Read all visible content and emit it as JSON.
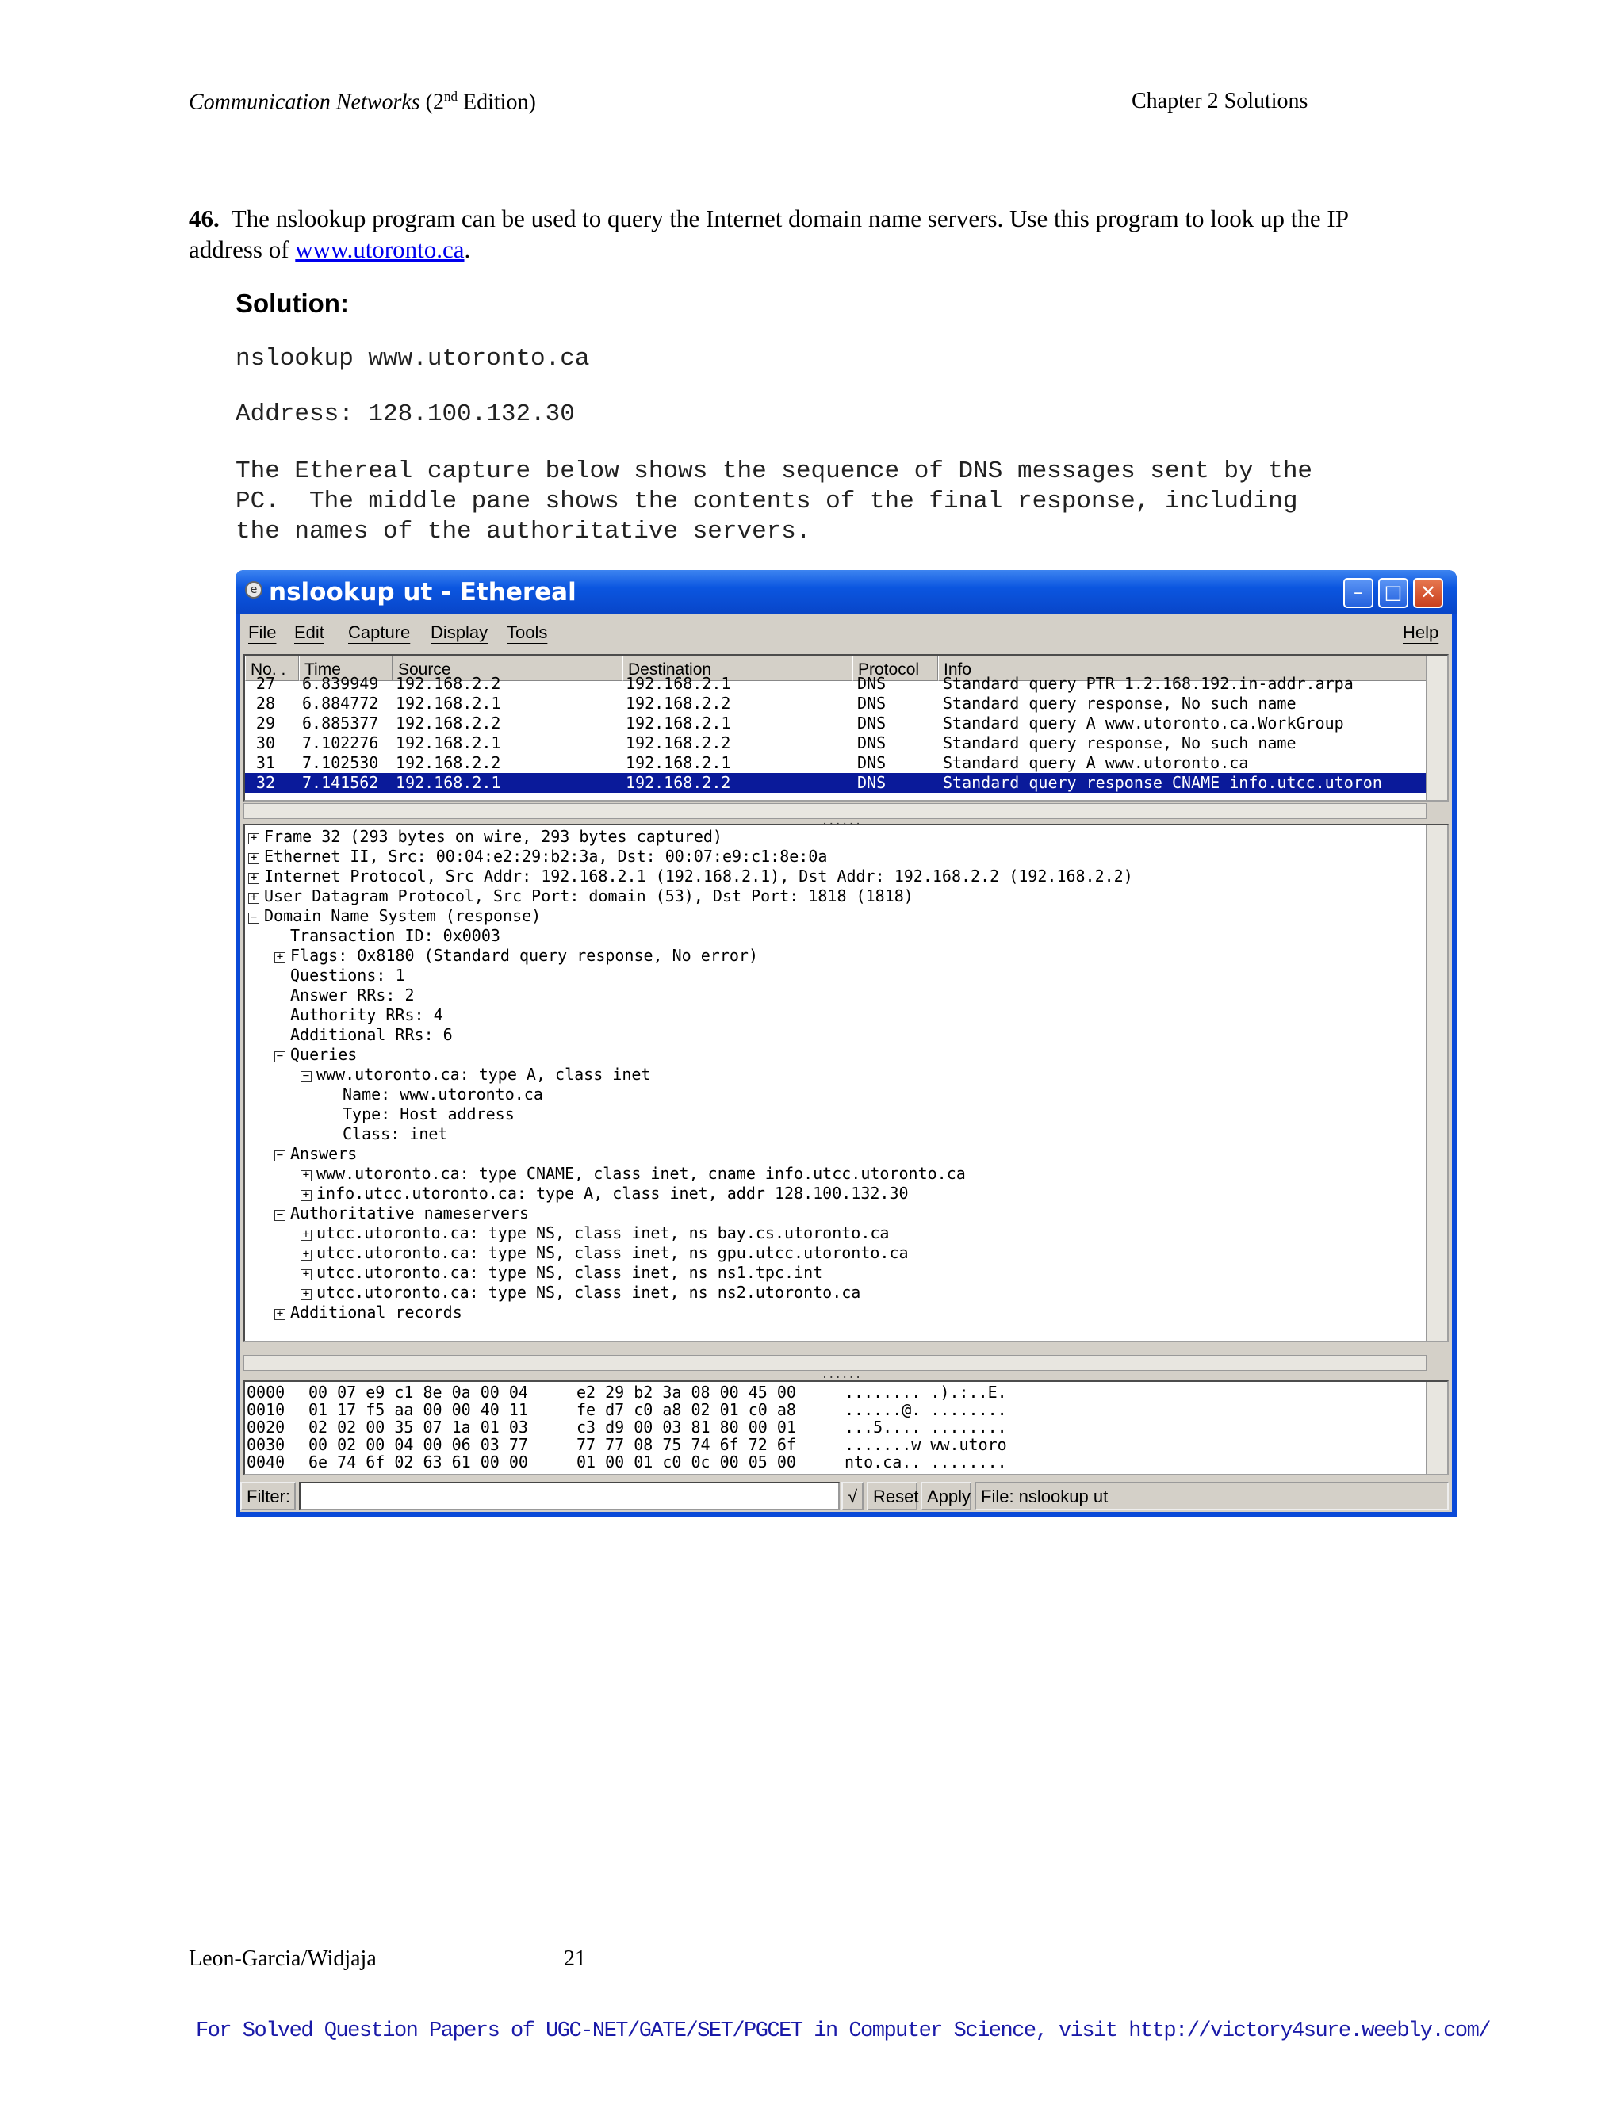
{
  "header": {
    "book_title": "Communication Networks",
    "edition_pre": "(2",
    "edition_sup": "nd",
    "edition_post": " Edition)",
    "chapter": "Chapter 2 Solutions"
  },
  "question": {
    "number": "46.",
    "text_before": "The nslookup  program can be used to query the Internet domain name servers. Use this program to look up the IP address of ",
    "link": "www.utoronto.ca",
    "text_after": "."
  },
  "solution": {
    "heading": "Solution:",
    "command": "nslookup www.utoronto.ca",
    "address": "Address: 128.100.132.30",
    "description": "The Ethereal capture below shows the sequence of DNS messages sent by the\nPC.  The middle pane shows the contents of the final response, including\nthe names of the authoritative servers."
  },
  "window": {
    "title": "nslookup ut - Ethereal",
    "icon": "ethereal-icon",
    "menus": [
      "File",
      "Edit",
      "Capture",
      "Display",
      "Tools"
    ],
    "help_menu": "Help",
    "columns": [
      "No. .",
      "Time",
      "Source",
      "Destination",
      "Protocol",
      "Info"
    ],
    "packets": [
      {
        "no": "27",
        "time": "6.839949",
        "src": "192.168.2.2",
        "dst": "192.168.2.1",
        "proto": "DNS",
        "info": "Standard query PTR 1.2.168.192.in-addr.arpa"
      },
      {
        "no": "28",
        "time": "6.884772",
        "src": "192.168.2.1",
        "dst": "192.168.2.2",
        "proto": "DNS",
        "info": "Standard query response, No such name"
      },
      {
        "no": "29",
        "time": "6.885377",
        "src": "192.168.2.2",
        "dst": "192.168.2.1",
        "proto": "DNS",
        "info": "Standard query A www.utoronto.ca.WorkGroup"
      },
      {
        "no": "30",
        "time": "7.102276",
        "src": "192.168.2.1",
        "dst": "192.168.2.2",
        "proto": "DNS",
        "info": "Standard query response, No such name"
      },
      {
        "no": "31",
        "time": "7.102530",
        "src": "192.168.2.2",
        "dst": "192.168.2.1",
        "proto": "DNS",
        "info": "Standard query A www.utoronto.ca"
      },
      {
        "no": "32",
        "time": "7.141562",
        "src": "192.168.2.1",
        "dst": "192.168.2.2",
        "proto": "DNS",
        "info": "Standard query response CNAME info.utcc.utoron"
      }
    ],
    "selected_packet": "32",
    "tree": [
      {
        "indent": 0,
        "exp": "+",
        "text": "Frame 32 (293 bytes on wire, 293 bytes captured)"
      },
      {
        "indent": 0,
        "exp": "+",
        "text": "Ethernet II, Src: 00:04:e2:29:b2:3a, Dst: 00:07:e9:c1:8e:0a"
      },
      {
        "indent": 0,
        "exp": "+",
        "text": "Internet Protocol, Src Addr: 192.168.2.1 (192.168.2.1), Dst Addr: 192.168.2.2 (192.168.2.2)"
      },
      {
        "indent": 0,
        "exp": "+",
        "text": "User Datagram Protocol, Src Port: domain (53), Dst Port: 1818 (1818)"
      },
      {
        "indent": 0,
        "exp": "-",
        "text": "Domain Name System (response)"
      },
      {
        "indent": 1,
        "exp": "",
        "text": "Transaction ID: 0x0003"
      },
      {
        "indent": 1,
        "exp": "+",
        "text": "Flags: 0x8180 (Standard query response, No error)"
      },
      {
        "indent": 1,
        "exp": "",
        "text": "Questions: 1"
      },
      {
        "indent": 1,
        "exp": "",
        "text": "Answer RRs: 2"
      },
      {
        "indent": 1,
        "exp": "",
        "text": "Authority RRs: 4"
      },
      {
        "indent": 1,
        "exp": "",
        "text": "Additional RRs: 6"
      },
      {
        "indent": 1,
        "exp": "-",
        "text": "Queries"
      },
      {
        "indent": 2,
        "exp": "-",
        "text": "www.utoronto.ca: type A, class inet"
      },
      {
        "indent": 3,
        "exp": "",
        "text": "Name: www.utoronto.ca"
      },
      {
        "indent": 3,
        "exp": "",
        "text": "Type: Host address"
      },
      {
        "indent": 3,
        "exp": "",
        "text": "Class: inet"
      },
      {
        "indent": 1,
        "exp": "-",
        "text": "Answers"
      },
      {
        "indent": 2,
        "exp": "+",
        "text": "www.utoronto.ca: type CNAME, class inet, cname info.utcc.utoronto.ca"
      },
      {
        "indent": 2,
        "exp": "+",
        "text": "info.utcc.utoronto.ca: type A, class inet, addr 128.100.132.30"
      },
      {
        "indent": 1,
        "exp": "-",
        "text": "Authoritative nameservers"
      },
      {
        "indent": 2,
        "exp": "+",
        "text": "utcc.utoronto.ca: type NS, class inet, ns bay.cs.utoronto.ca"
      },
      {
        "indent": 2,
        "exp": "+",
        "text": "utcc.utoronto.ca: type NS, class inet, ns gpu.utcc.utoronto.ca"
      },
      {
        "indent": 2,
        "exp": "+",
        "text": "utcc.utoronto.ca: type NS, class inet, ns ns1.tpc.int"
      },
      {
        "indent": 2,
        "exp": "+",
        "text": "utcc.utoronto.ca: type NS, class inet, ns ns2.utoronto.ca"
      },
      {
        "indent": 1,
        "exp": "+",
        "text": "Additional records"
      }
    ],
    "hex": [
      {
        "off": "0000",
        "bytes1": "00 07 e9 c1 8e 0a 00 04",
        "bytes2": "e2 29 b2 3a 08 00 45 00",
        "ascii": "........ .).:..E."
      },
      {
        "off": "0010",
        "bytes1": "01 17 f5 aa 00 00 40 11",
        "bytes2": "fe d7 c0 a8 02 01 c0 a8",
        "ascii": "......@. ........"
      },
      {
        "off": "0020",
        "bytes1": "02 02 00 35 07 1a 01 03",
        "bytes2": "c3 d9 00 03 81 80 00 01",
        "ascii": "...5.... ........"
      },
      {
        "off": "0030",
        "bytes1": "00 02 00 04 00 06 03 77",
        "bytes2": "77 77 08 75 74 6f 72 6f",
        "ascii": ".......w ww.utoro"
      },
      {
        "off": "0040",
        "bytes1": "6e 74 6f 02 63 61 00 00",
        "bytes2": "01 00 01 c0 0c 00 05 00",
        "ascii": "nto.ca.. ........"
      }
    ],
    "filter_label": "Filter:",
    "filter_value": "",
    "reset_label": "Reset",
    "apply_label": "Apply",
    "file_status": "File: nslookup ut"
  },
  "footer": {
    "authors": "Leon-Garcia/Widjaja",
    "page": "21",
    "promo": "For Solved Question Papers of UGC-NET/GATE/SET/PGCET in Computer Science, visit http://victory4sure.weebly.com/"
  }
}
